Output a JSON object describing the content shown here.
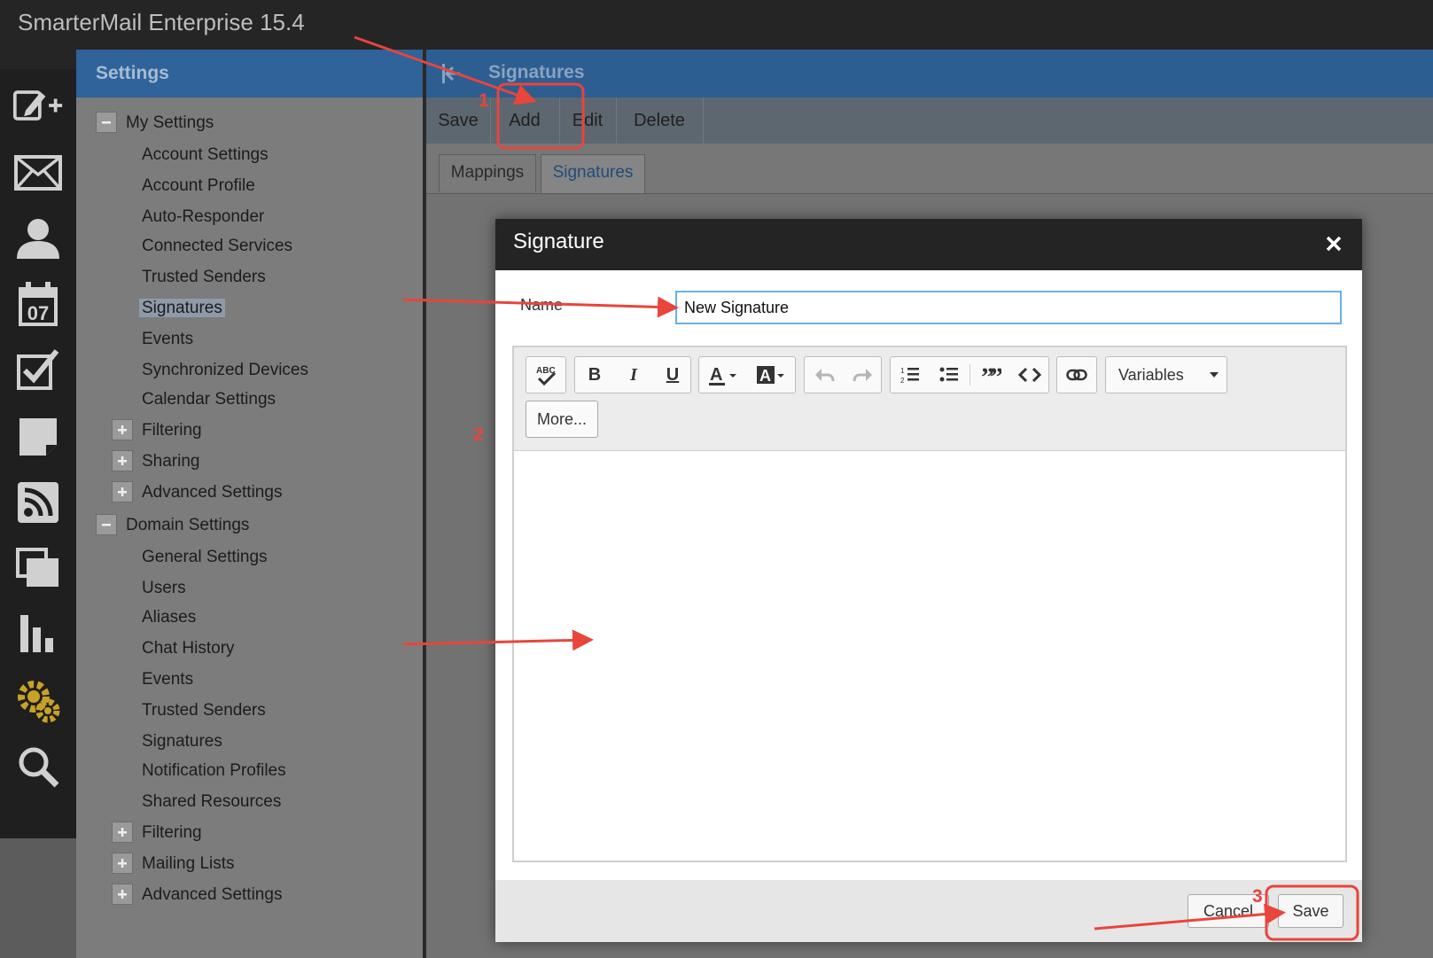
{
  "app": {
    "title": "SmarterMail Enterprise 15.4"
  },
  "iconbar": [
    {
      "name": "compose-icon"
    },
    {
      "name": "mail-icon"
    },
    {
      "name": "contacts-icon"
    },
    {
      "name": "calendar-icon",
      "text": "07"
    },
    {
      "name": "tasks-icon"
    },
    {
      "name": "notes-icon"
    },
    {
      "name": "rss-icon"
    },
    {
      "name": "file-storage-icon"
    },
    {
      "name": "reports-icon"
    },
    {
      "name": "settings-gear-icon"
    },
    {
      "name": "search-icon"
    }
  ],
  "settings": {
    "title": "Settings",
    "my_settings": {
      "label": "My Settings",
      "items": [
        "Account Settings",
        "Account Profile",
        "Auto-Responder",
        "Connected Services",
        "Trusted Senders",
        "Signatures",
        "Events",
        "Synchronized Devices",
        "Calendar Settings"
      ],
      "groups": [
        "Filtering",
        "Sharing",
        "Advanced Settings"
      ]
    },
    "domain_settings": {
      "label": "Domain Settings",
      "items": [
        "General Settings",
        "Users",
        "Aliases",
        "Chat History",
        "Events",
        "Trusted Senders",
        "Signatures",
        "Notification Profiles",
        "Shared Resources"
      ],
      "groups": [
        "Filtering",
        "Mailing Lists",
        "Advanced Settings"
      ]
    }
  },
  "main": {
    "title": "Signatures",
    "toolbar": {
      "save": "Save",
      "add": "Add",
      "edit": "Edit",
      "delete": "Delete"
    },
    "tabs": [
      "Mappings",
      "Signatures"
    ]
  },
  "dialog": {
    "title": "Signature",
    "close": "×",
    "name_label": "Name",
    "name_value": "New Signature",
    "variables": "Variables",
    "more": "More...",
    "cancel": "Cancel",
    "save": "Save"
  },
  "annotations": {
    "step1": "1",
    "step2": "2",
    "step3": "3"
  },
  "colors": {
    "accent": "#2f6399",
    "annotation": "#e8453c",
    "input_focus": "#6cb0e6"
  }
}
